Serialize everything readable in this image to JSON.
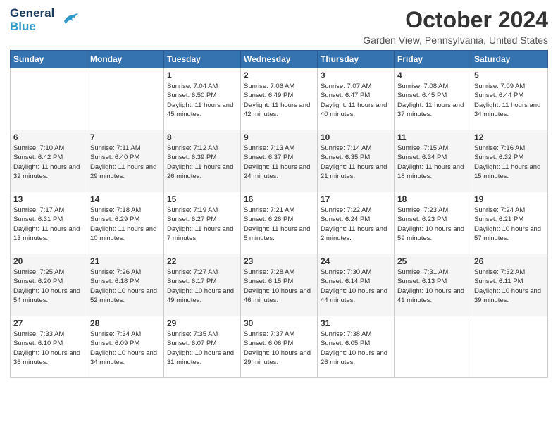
{
  "logo": {
    "general": "General",
    "blue": "Blue",
    "bird_symbol": "▶"
  },
  "header": {
    "month_title": "October 2024",
    "location": "Garden View, Pennsylvania, United States"
  },
  "days_of_week": [
    "Sunday",
    "Monday",
    "Tuesday",
    "Wednesday",
    "Thursday",
    "Friday",
    "Saturday"
  ],
  "weeks": [
    [
      {
        "day": "",
        "info": ""
      },
      {
        "day": "",
        "info": ""
      },
      {
        "day": "1",
        "info": "Sunrise: 7:04 AM\nSunset: 6:50 PM\nDaylight: 11 hours and 45 minutes."
      },
      {
        "day": "2",
        "info": "Sunrise: 7:06 AM\nSunset: 6:49 PM\nDaylight: 11 hours and 42 minutes."
      },
      {
        "day": "3",
        "info": "Sunrise: 7:07 AM\nSunset: 6:47 PM\nDaylight: 11 hours and 40 minutes."
      },
      {
        "day": "4",
        "info": "Sunrise: 7:08 AM\nSunset: 6:45 PM\nDaylight: 11 hours and 37 minutes."
      },
      {
        "day": "5",
        "info": "Sunrise: 7:09 AM\nSunset: 6:44 PM\nDaylight: 11 hours and 34 minutes."
      }
    ],
    [
      {
        "day": "6",
        "info": "Sunrise: 7:10 AM\nSunset: 6:42 PM\nDaylight: 11 hours and 32 minutes."
      },
      {
        "day": "7",
        "info": "Sunrise: 7:11 AM\nSunset: 6:40 PM\nDaylight: 11 hours and 29 minutes."
      },
      {
        "day": "8",
        "info": "Sunrise: 7:12 AM\nSunset: 6:39 PM\nDaylight: 11 hours and 26 minutes."
      },
      {
        "day": "9",
        "info": "Sunrise: 7:13 AM\nSunset: 6:37 PM\nDaylight: 11 hours and 24 minutes."
      },
      {
        "day": "10",
        "info": "Sunrise: 7:14 AM\nSunset: 6:35 PM\nDaylight: 11 hours and 21 minutes."
      },
      {
        "day": "11",
        "info": "Sunrise: 7:15 AM\nSunset: 6:34 PM\nDaylight: 11 hours and 18 minutes."
      },
      {
        "day": "12",
        "info": "Sunrise: 7:16 AM\nSunset: 6:32 PM\nDaylight: 11 hours and 15 minutes."
      }
    ],
    [
      {
        "day": "13",
        "info": "Sunrise: 7:17 AM\nSunset: 6:31 PM\nDaylight: 11 hours and 13 minutes."
      },
      {
        "day": "14",
        "info": "Sunrise: 7:18 AM\nSunset: 6:29 PM\nDaylight: 11 hours and 10 minutes."
      },
      {
        "day": "15",
        "info": "Sunrise: 7:19 AM\nSunset: 6:27 PM\nDaylight: 11 hours and 7 minutes."
      },
      {
        "day": "16",
        "info": "Sunrise: 7:21 AM\nSunset: 6:26 PM\nDaylight: 11 hours and 5 minutes."
      },
      {
        "day": "17",
        "info": "Sunrise: 7:22 AM\nSunset: 6:24 PM\nDaylight: 11 hours and 2 minutes."
      },
      {
        "day": "18",
        "info": "Sunrise: 7:23 AM\nSunset: 6:23 PM\nDaylight: 10 hours and 59 minutes."
      },
      {
        "day": "19",
        "info": "Sunrise: 7:24 AM\nSunset: 6:21 PM\nDaylight: 10 hours and 57 minutes."
      }
    ],
    [
      {
        "day": "20",
        "info": "Sunrise: 7:25 AM\nSunset: 6:20 PM\nDaylight: 10 hours and 54 minutes."
      },
      {
        "day": "21",
        "info": "Sunrise: 7:26 AM\nSunset: 6:18 PM\nDaylight: 10 hours and 52 minutes."
      },
      {
        "day": "22",
        "info": "Sunrise: 7:27 AM\nSunset: 6:17 PM\nDaylight: 10 hours and 49 minutes."
      },
      {
        "day": "23",
        "info": "Sunrise: 7:28 AM\nSunset: 6:15 PM\nDaylight: 10 hours and 46 minutes."
      },
      {
        "day": "24",
        "info": "Sunrise: 7:30 AM\nSunset: 6:14 PM\nDaylight: 10 hours and 44 minutes."
      },
      {
        "day": "25",
        "info": "Sunrise: 7:31 AM\nSunset: 6:13 PM\nDaylight: 10 hours and 41 minutes."
      },
      {
        "day": "26",
        "info": "Sunrise: 7:32 AM\nSunset: 6:11 PM\nDaylight: 10 hours and 39 minutes."
      }
    ],
    [
      {
        "day": "27",
        "info": "Sunrise: 7:33 AM\nSunset: 6:10 PM\nDaylight: 10 hours and 36 minutes."
      },
      {
        "day": "28",
        "info": "Sunrise: 7:34 AM\nSunset: 6:09 PM\nDaylight: 10 hours and 34 minutes."
      },
      {
        "day": "29",
        "info": "Sunrise: 7:35 AM\nSunset: 6:07 PM\nDaylight: 10 hours and 31 minutes."
      },
      {
        "day": "30",
        "info": "Sunrise: 7:37 AM\nSunset: 6:06 PM\nDaylight: 10 hours and 29 minutes."
      },
      {
        "day": "31",
        "info": "Sunrise: 7:38 AM\nSunset: 6:05 PM\nDaylight: 10 hours and 26 minutes."
      },
      {
        "day": "",
        "info": ""
      },
      {
        "day": "",
        "info": ""
      }
    ]
  ]
}
